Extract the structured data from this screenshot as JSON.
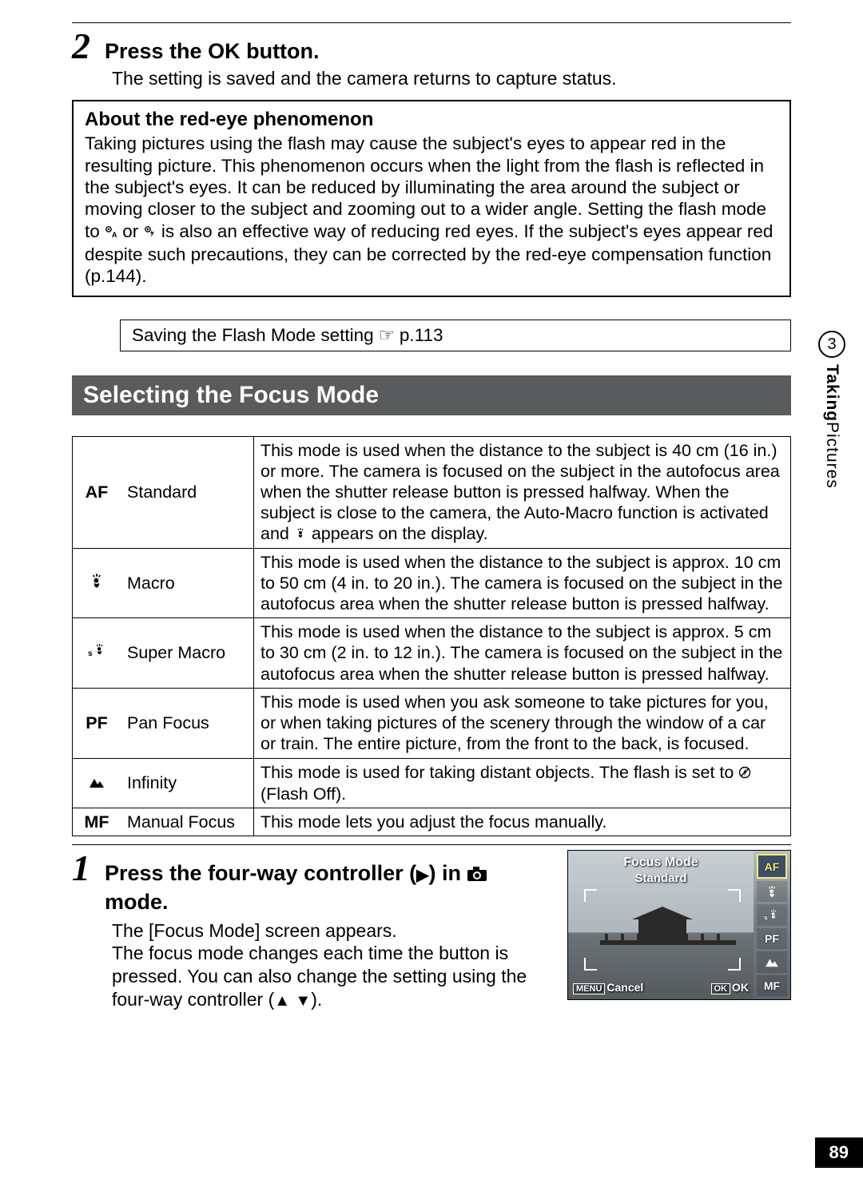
{
  "side": {
    "num": "3",
    "title_bold": "Taking",
    "title_rest": " Pictures"
  },
  "page_number": "89",
  "step2": {
    "num": "2",
    "title_a": "Press the ",
    "title_ok": "OK",
    "title_b": " button.",
    "body": "The setting is saved and the camera returns to capture status."
  },
  "redeye": {
    "title": "About the red-eye phenomenon",
    "body_a": "Taking pictures using the flash may cause the subject's eyes to appear red in the resulting picture. This phenomenon occurs when the light from the flash is reflected in the subject's eyes. It can be reduced by illuminating the area around the subject or moving closer to the subject and zooming out to a wider angle. Setting the flash mode to ",
    "body_b": " or ",
    "body_c": " is also an effective way of reducing red eyes. If the subject's eyes appear red despite such precautions, they can be corrected by the red-eye compensation function (p.144)."
  },
  "save_flash": {
    "text": "Saving the Flash Mode setting ",
    "ref": "p.113"
  },
  "section_title": "Selecting the Focus Mode",
  "focus_table": [
    {
      "icon": "AF",
      "name": "Standard",
      "desc_a": "This mode is used when the distance to the subject is 40 cm (16 in.) or more. The camera is focused on the subject in the autofocus area when the shutter release button is pressed halfway. When the subject is close to the camera, the Auto-Macro function is activated and ",
      "desc_b": " appears on the display."
    },
    {
      "icon": "macro",
      "name": "Macro",
      "desc": "This mode is used when the distance to the subject is approx. 10 cm to 50 cm (4 in. to 20 in.). The camera is focused on the subject in the autofocus area when the shutter release button is pressed halfway."
    },
    {
      "icon": "smacro",
      "name": "Super Macro",
      "desc": "This mode is used when the distance to the subject is approx. 5 cm to 30 cm (2 in. to 12 in.). The camera is focused on the subject in the autofocus area when the shutter release button is pressed halfway."
    },
    {
      "icon": "PF",
      "name": "Pan Focus",
      "desc": "This mode is used when you ask someone to take pictures for you, or when taking pictures of the scenery through the window of a car or train. The entire picture, from the front to the back, is focused."
    },
    {
      "icon": "infinity",
      "name": "Infinity",
      "desc_a": "This mode is used for taking distant objects. The flash is set to ",
      "desc_b": " (Flash Off)."
    },
    {
      "icon": "MF",
      "name": "Manual Focus",
      "desc": "This mode lets you adjust the focus manually."
    }
  ],
  "step1": {
    "num": "1",
    "title_a": "Press the four-way controller (",
    "title_arrow": "▶",
    "title_b": ") in ",
    "title_c": " mode.",
    "body_a": "The [Focus Mode] screen appears.",
    "body_b_a": "The focus mode changes each time the button is pressed. You can also change the setting using the four-way controller (",
    "body_b_up": "▲",
    "body_b_dn": "▼",
    "body_b_b": ")."
  },
  "lcd": {
    "title1": "Focus Mode",
    "title2": "Standard",
    "menu_btn": "MENU",
    "cancel": "Cancel",
    "ok_btn": "OK",
    "ok_lbl": "OK",
    "options": [
      "AF",
      "macro",
      "smacro",
      "PF",
      "infinity",
      "MF"
    ]
  }
}
